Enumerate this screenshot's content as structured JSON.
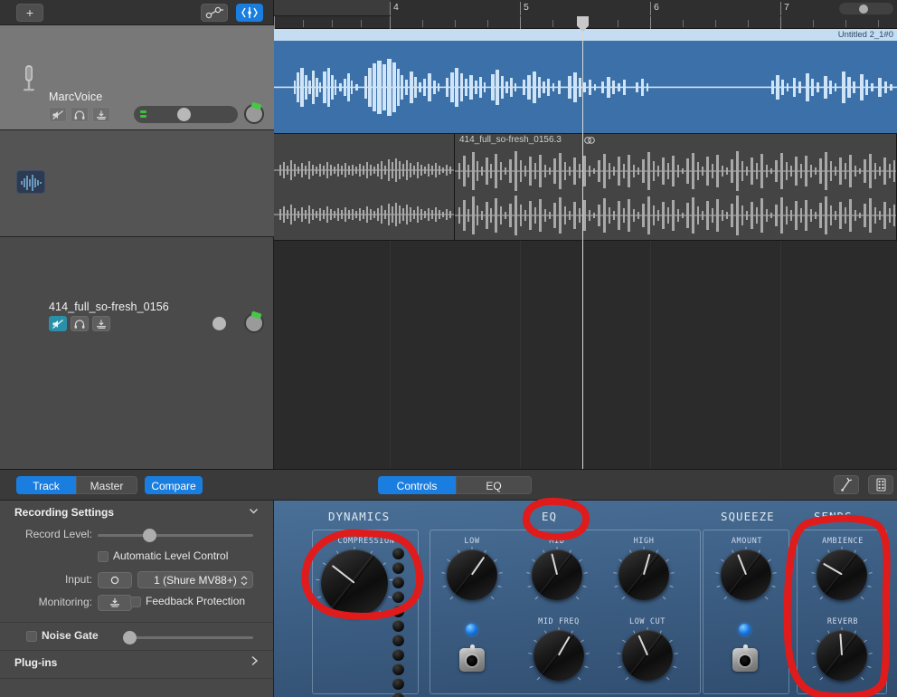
{
  "window": {
    "app": "GarageBand"
  },
  "toolbar": {
    "add_track_label": "+",
    "automation_icon": "automation-curve-icon",
    "flex_icon": "flex-time-icon"
  },
  "timeline": {
    "bars": [
      "4",
      "5",
      "6",
      "7"
    ],
    "playhead_bar": "5.4",
    "zoom_label": "zoom-slider"
  },
  "tracks": [
    {
      "name": "MarcVoice",
      "icon": "microphone-icon",
      "mute_on": false,
      "solo_on": false,
      "record_enabled": false,
      "volume": 48,
      "pan": 62,
      "region": {
        "name": "Untitled 2_1#0",
        "color": "#3c70a8"
      }
    },
    {
      "name": "414_full_so-fresh_0156",
      "icon": "audio-waveform-icon",
      "mute_on": true,
      "solo_on": false,
      "record_enabled": false,
      "volume": 85,
      "pan": 62,
      "region": {
        "name": "414_full_so-fresh_0156.3",
        "channel": "stereo",
        "color": "#444444"
      }
    }
  ],
  "editor": {
    "left_tabs": [
      {
        "label": "Track",
        "selected": true
      },
      {
        "label": "Master",
        "selected": false
      }
    ],
    "compare_label": "Compare",
    "center_tabs": [
      {
        "label": "Controls",
        "selected": true
      },
      {
        "label": "EQ",
        "selected": false
      }
    ],
    "right_icons": [
      "tuning-fork-icon",
      "keyboard-grid-icon"
    ]
  },
  "inspector": {
    "section_title": "Recording Settings",
    "collapse_icon": "chevron-down-icon",
    "record_level": {
      "label": "Record Level:",
      "value": 33
    },
    "automatic_level_control": {
      "label": "Automatic Level Control",
      "checked": false
    },
    "input": {
      "label": "Input:",
      "mono_icon": "mono-input-icon",
      "value": "1  (Shure MV88+)"
    },
    "monitoring": {
      "label": "Monitoring:",
      "icon": "monitoring-icon"
    },
    "feedback_protection": {
      "label": "Feedback Protection",
      "checked": false
    },
    "noise_gate": {
      "label": "Noise Gate",
      "checked": false,
      "value": 3
    },
    "plugins": {
      "label": "Plug-ins",
      "arrow_icon": "chevron-right-icon"
    }
  },
  "smart_controls": {
    "groups": [
      {
        "title": "DYNAMICS",
        "knobs": [
          {
            "label": "COMPRESSION",
            "angle": -52
          }
        ],
        "leds": 11
      },
      {
        "title": "EQ",
        "knobs": [
          {
            "label": "LOW",
            "angle": 35
          },
          {
            "label": "MID",
            "angle": -14
          },
          {
            "label": "HIGH",
            "angle": 16
          },
          {
            "label": "MID FREQ",
            "angle": 30
          },
          {
            "label": "LOW CUT",
            "angle": -24
          }
        ],
        "has_toggle": true
      },
      {
        "title": "SQUEEZE",
        "knobs": [
          {
            "label": "AMOUNT",
            "angle": -22
          }
        ],
        "has_toggle": true
      },
      {
        "title": "SENDS",
        "knobs": [
          {
            "label": "AMBIENCE",
            "angle": -60
          },
          {
            "label": "REVERB",
            "angle": -4
          }
        ]
      }
    ]
  },
  "annotations": {
    "color": "#e01b1b",
    "marks": [
      "compression-knob-circle",
      "eq-title-circle",
      "sends-knobs-circle"
    ]
  }
}
